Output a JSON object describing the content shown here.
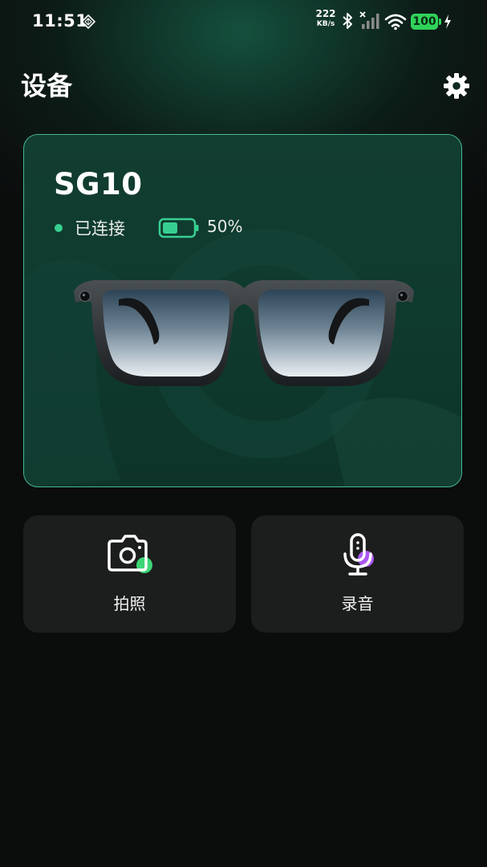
{
  "status_bar": {
    "time": "11:51",
    "net_speed_value": "222",
    "net_speed_unit": "KB/s",
    "battery_level": "100",
    "icons": [
      "diamond-notification-icon",
      "bluetooth-icon",
      "no-signal-icon",
      "wifi-icon",
      "battery-icon",
      "charging-bolt-icon"
    ]
  },
  "header": {
    "title": "设备",
    "settings_icon": "gear-icon"
  },
  "device": {
    "name": "SG10",
    "status": "已连接",
    "battery_percent": "50%",
    "battery_fraction": 0.5,
    "image": "smart-glasses-image"
  },
  "actions": [
    {
      "label": "拍照",
      "icon": "camera-icon",
      "accent": "#3fe07a"
    },
    {
      "label": "录音",
      "icon": "microphone-icon",
      "accent": "#b25cff"
    }
  ],
  "colors": {
    "background": "#0b0c0c",
    "card_border": "#46b894",
    "connected": "#37cf91",
    "status_battery": "#2fd35a"
  }
}
